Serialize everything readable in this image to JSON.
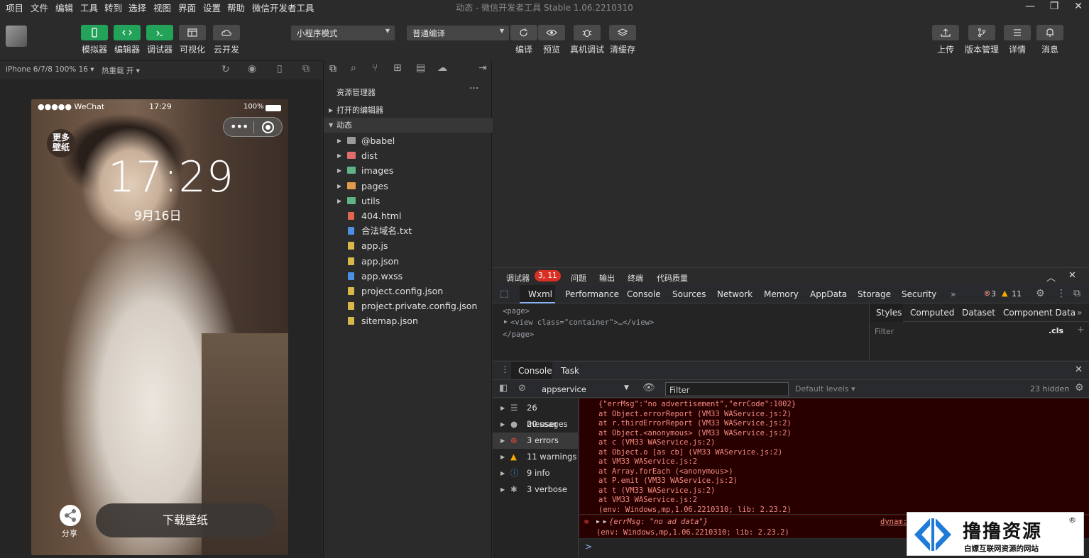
{
  "menu": [
    "项目",
    "文件",
    "编辑",
    "工具",
    "转到",
    "选择",
    "视图",
    "界面",
    "设置",
    "帮助",
    "微信开发者工具"
  ],
  "window_title": "动态 - 微信开发者工具 Stable 1.06.2210310",
  "toolbar": {
    "left_buttons": [
      "模拟器",
      "编辑器",
      "调试器",
      "可视化",
      "云开发"
    ],
    "mode_select": "小程序模式",
    "compile_select": "普通编译",
    "mid_buttons": [
      "编译",
      "预览",
      "真机调试",
      "清缓存"
    ],
    "right_buttons": [
      "上传",
      "版本管理",
      "详情",
      "消息"
    ]
  },
  "simbar": {
    "device": "iPhone 6/7/8 100% 16",
    "hotreload": "热重载 开"
  },
  "phone": {
    "signal": "●●●●● WeChat",
    "clock": "17:29",
    "battery": "100%",
    "big_time": "17:29",
    "date": "9月16日",
    "more_badge": "更多壁纸",
    "download": "下载壁纸",
    "share": "分享"
  },
  "explorer": {
    "title": "资源管理器",
    "sections": [
      "打开的编辑器",
      "动态"
    ],
    "items": [
      {
        "name": "@babel",
        "type": "folder",
        "color": "#9a9a9a"
      },
      {
        "name": "dist",
        "type": "folder",
        "color": "#e06c6c"
      },
      {
        "name": "images",
        "type": "folder",
        "color": "#5fb386"
      },
      {
        "name": "pages",
        "type": "folder",
        "color": "#e39a4c"
      },
      {
        "name": "utils",
        "type": "folder",
        "color": "#5fb386"
      },
      {
        "name": "404.html",
        "type": "file",
        "color": "#e3664c"
      },
      {
        "name": "合法域名.txt",
        "type": "file",
        "color": "#4c8fe3"
      },
      {
        "name": "app.js",
        "type": "file",
        "color": "#d9b84a"
      },
      {
        "name": "app.json",
        "type": "file",
        "color": "#d9b84a"
      },
      {
        "name": "app.wxss",
        "type": "file",
        "color": "#4c8fe3"
      },
      {
        "name": "project.config.json",
        "type": "file",
        "color": "#d9b84a"
      },
      {
        "name": "project.private.config.json",
        "type": "file",
        "color": "#d9b84a"
      },
      {
        "name": "sitemap.json",
        "type": "file",
        "color": "#d9b84a"
      }
    ]
  },
  "debugger": {
    "tabs": [
      "调试器",
      "问题",
      "输出",
      "终端",
      "代码质量"
    ],
    "badge": "3, 11",
    "devtools_tabs": [
      "Wxml",
      "Performance",
      "Console",
      "Sources",
      "Network",
      "Memory",
      "AppData",
      "Storage",
      "Security"
    ],
    "error_count": "3",
    "warning_count": "11",
    "wxml": [
      "<page>",
      "<view class=\"container\">…</view>",
      "</page>"
    ],
    "styles_tabs": [
      "Styles",
      "Computed",
      "Dataset",
      "Component Data"
    ],
    "filter_placeholder": "Filter",
    "cls": ".cls"
  },
  "console": {
    "tabs": [
      "Console",
      "Task"
    ],
    "context": "appservice",
    "filter": "Filter",
    "levels": "Default levels",
    "hidden": "23 hidden",
    "sidebar": [
      "26 messages",
      "20 user mes...",
      "3 errors",
      "11 warnings",
      "9 info",
      "3 verbose"
    ],
    "error_lines": [
      "{\"errMsg\":\"no advertisement\",\"errCode\":1002}",
      "    at Object.errorReport (VM33 WAService.js:2)",
      "    at r.thirdErrorReport (VM33 WAService.js:2)",
      "    at Object.<anonymous> (VM33 WAService.js:2)",
      "    at c (VM33 WAService.js:2)",
      "    at Object.o [as cb] (VM33 WAService.js:2)",
      "    at VM33 WAService.js:2",
      "    at Array.forEach (<anonymous>)",
      "    at P.emit (VM33 WAService.js:2)",
      "    at t (VM33 WAService.js:2)",
      "    at VM33 WAService.js:2",
      "(env: Windows,mp,1.06.2210310; lib: 2.23.2)"
    ],
    "error2_line1": "{errMsg: \"no ad data\"}",
    "error2_line2": "(env: Windows,mp,1.06.2210310; lib: 2.23.2)",
    "error2_source": "dynam:",
    "prompt": ">"
  },
  "watermark": {
    "title": "撸撸资源",
    "subtitle": "白嫖互联网资源的网站",
    "mark": "®"
  }
}
